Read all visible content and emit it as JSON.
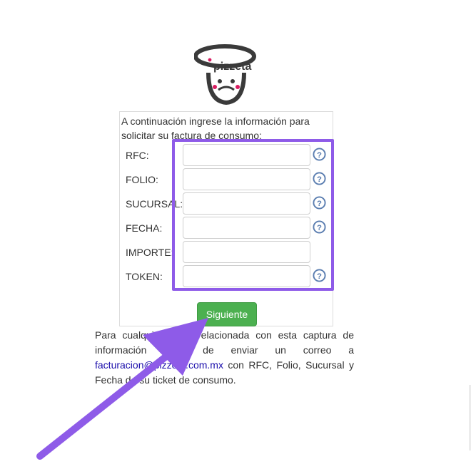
{
  "logo": {
    "text": "pizzeta"
  },
  "form": {
    "intro": "A continuación ingrese la información para solicitar su factura de consumo:",
    "fields": [
      {
        "label": "RFC:",
        "value": "",
        "has_help": true
      },
      {
        "label": "FOLIO:",
        "value": "",
        "has_help": true
      },
      {
        "label": "SUCURSAL:",
        "value": "",
        "has_help": true
      },
      {
        "label": "FECHA:",
        "value": "",
        "has_help": true
      },
      {
        "label": "IMPORTE:",
        "value": "",
        "has_help": false
      },
      {
        "label": "TOKEN:",
        "value": "",
        "has_help": true
      }
    ],
    "help_symbol": "?",
    "submit_label": "Siguiente"
  },
  "note": {
    "part1": "Para cualquier duda relacionada con esta captura de información favor de enviar un correo a ",
    "email": "facturacion@pizzeta.com.mx",
    "part2": " con RFC, Folio, Sucursal y Fecha de su ticket de consumo."
  },
  "colors": {
    "highlight": "#8e5be8",
    "button": "#4cb050",
    "help_icon": "#5a7db0",
    "link": "#1a0dab"
  }
}
